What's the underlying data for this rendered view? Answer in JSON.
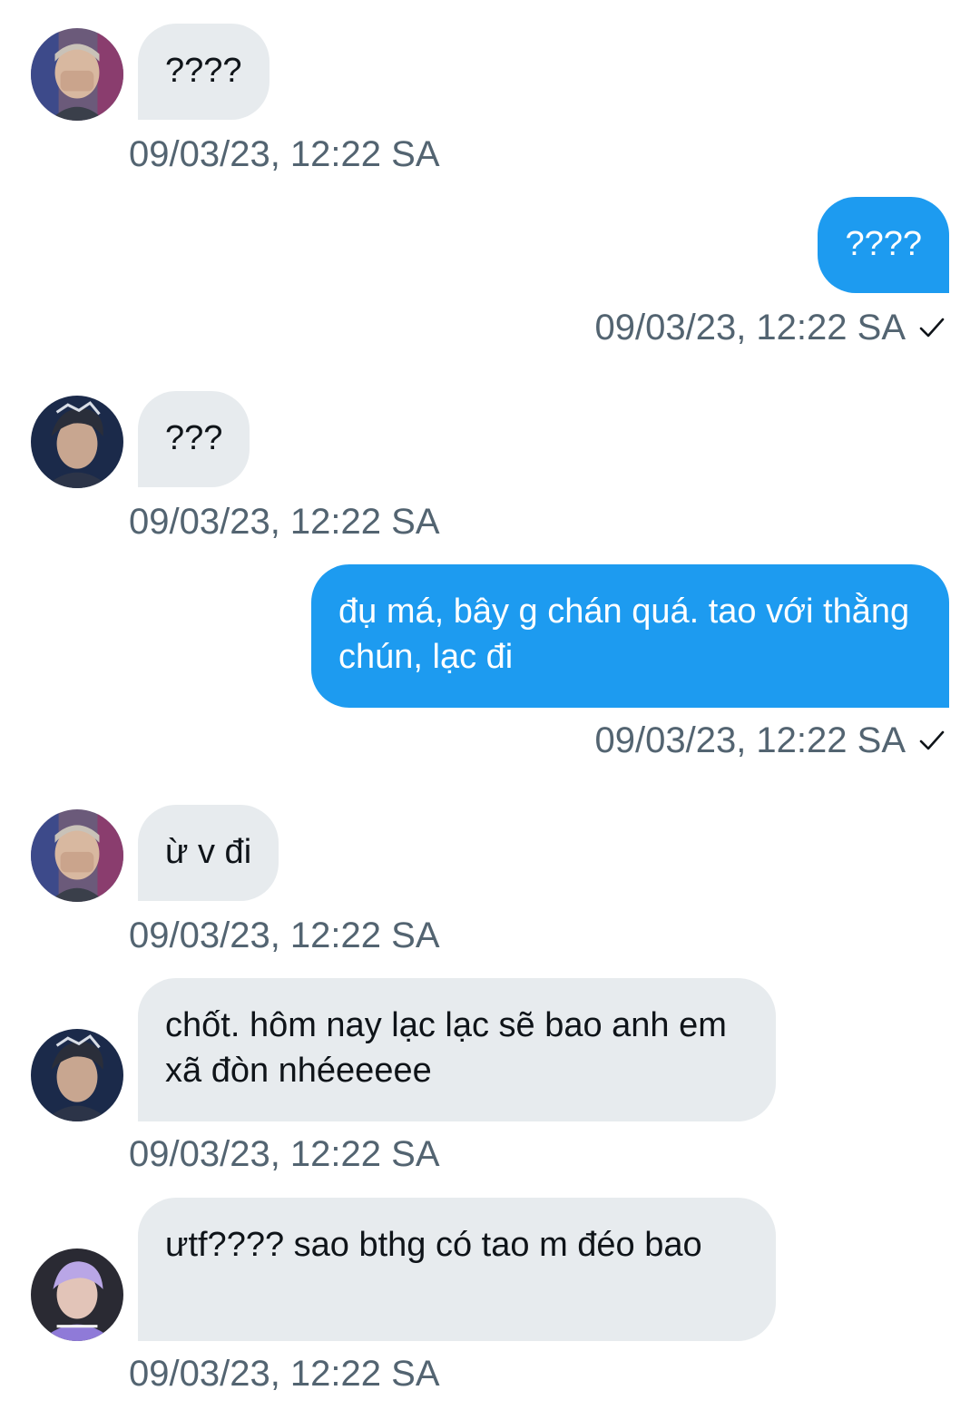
{
  "messages": [
    {
      "direction": "in",
      "avatar": "avatar-1",
      "text": "????",
      "time": "09/03/23, 12:22 SA"
    },
    {
      "direction": "out",
      "text": "????",
      "time": "09/03/23, 12:22 SA",
      "status_icon": "check-icon"
    },
    {
      "direction": "in",
      "avatar": "avatar-2",
      "text": "???",
      "time": "09/03/23, 12:22 SA"
    },
    {
      "direction": "out",
      "text": "đụ má, bây g chán quá. tao với thằng chún, lạc đi",
      "time": "09/03/23, 12:22 SA",
      "status_icon": "check-icon"
    },
    {
      "direction": "in",
      "avatar": "avatar-1",
      "text": "ừ v đi",
      "time": "09/03/23, 12:22 SA"
    },
    {
      "direction": "in",
      "avatar": "avatar-2",
      "text": "chốt. hôm nay lạc lạc sẽ bao anh em xã đòn nhéeeeee",
      "time": "09/03/23, 12:22 SA"
    },
    {
      "direction": "in",
      "avatar": "avatar-3",
      "text": "ưtf???? sao bthg có tao m đéo bao",
      "time": "09/03/23, 12:22 SA"
    }
  ],
  "colors": {
    "incoming_bubble": "#e7ebee",
    "outgoing_bubble": "#1d9bf0",
    "timestamp": "#536471",
    "text": "#0f1419"
  }
}
